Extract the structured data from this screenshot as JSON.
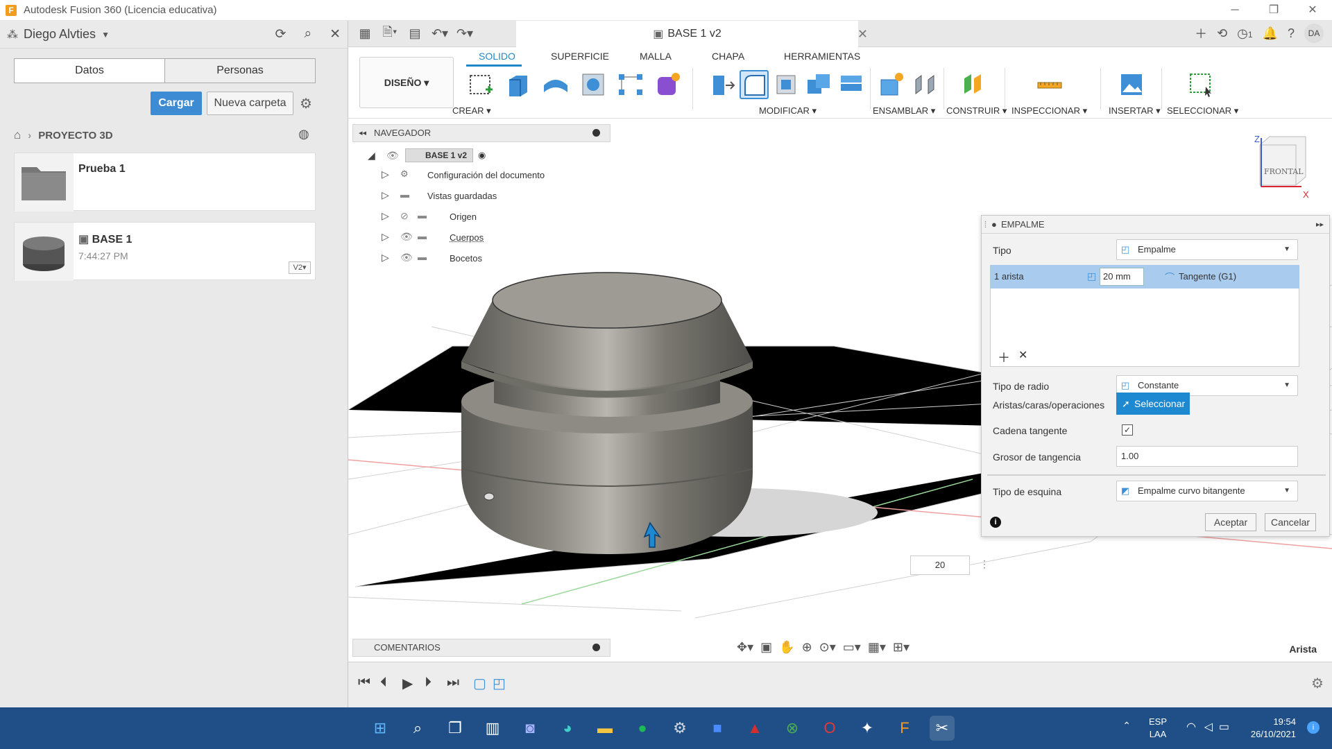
{
  "window": {
    "title": "Autodesk Fusion 360 (Licencia educativa)",
    "app_letter": "F"
  },
  "left_panel": {
    "user": "Diego Alvties",
    "tabs": [
      "Datos",
      "Personas"
    ],
    "upload_label": "Cargar",
    "new_folder_label": "Nueva carpeta",
    "breadcrumb": "PROYECTO 3D",
    "items": [
      {
        "name": "Prueba 1",
        "time": ""
      },
      {
        "name": "BASE 1",
        "time": "7:44:27 PM",
        "version": "V2▾"
      }
    ]
  },
  "document": {
    "tab_title": "BASE 1 v2"
  },
  "ribbon": {
    "design_label": "DISEÑO ▾",
    "tabs": [
      "SOLIDO",
      "SUPERFICIE",
      "MALLA",
      "CHAPA",
      "HERRAMIENTAS"
    ],
    "groups": [
      "CREAR ▾",
      "MODIFICAR ▾",
      "ENSAMBLAR ▾",
      "CONSTRUIR ▾",
      "INSPECCIONAR ▾",
      "INSERTAR ▾",
      "SELECCIONAR ▾"
    ]
  },
  "top_right": {
    "jobs_count": "1",
    "avatar_initials": "DA"
  },
  "navigator": {
    "title": "NAVEGADOR",
    "root": "BASE 1 v2",
    "nodes": [
      "Configuración del documento",
      "Vistas guardadas",
      "Origen",
      "Cuerpos",
      "Bocetos"
    ]
  },
  "viewcube": {
    "label": "FRONTAL",
    "axis_z": "Z",
    "axis_x": "X"
  },
  "dialog": {
    "title": "EMPALME",
    "tipo_label": "Tipo",
    "tipo_value": "Empalme",
    "edge_label": "1 arista",
    "edge_value": "20 mm",
    "edge_continuity": "Tangente (G1)",
    "radio_label": "Tipo de radio",
    "radio_value": "Constante",
    "aristas_label": "Aristas/caras/operaciones",
    "select_label": "Seleccionar",
    "cadena_label": "Cadena tangente",
    "grosor_label": "Grosor de tangencia",
    "grosor_value": "1.00",
    "esquina_label": "Tipo de esquina",
    "esquina_value": "Empalme curvo bitangente",
    "accept_label": "Aceptar",
    "cancel_label": "Cancelar"
  },
  "hud_value": "20",
  "status_text": "Arista",
  "comments_label": "COMENTARIOS",
  "taskbar": {
    "lang": "ESP",
    "lang2": "LAA",
    "time": "19:54",
    "date": "26/10/2021"
  }
}
